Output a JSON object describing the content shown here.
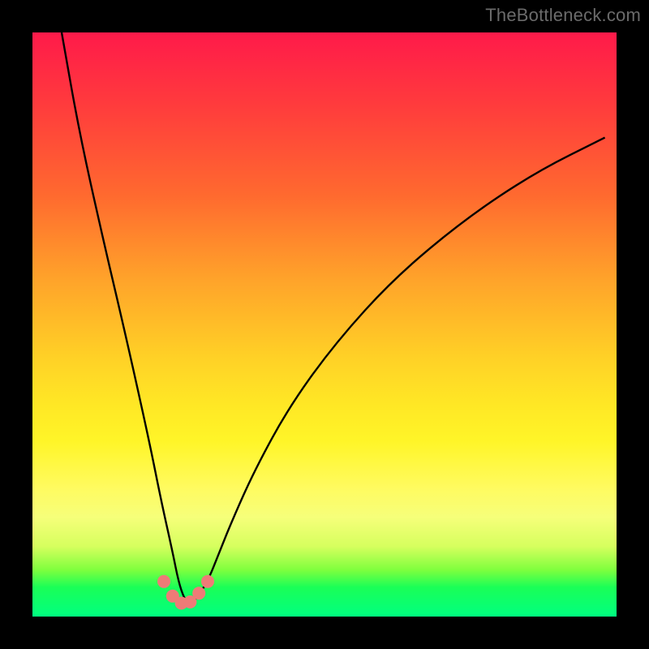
{
  "watermark": "TheBottleneck.com",
  "colors": {
    "background": "#000000",
    "gradient_top": "#ff1a4a",
    "gradient_bottom": "#00ff80",
    "curve": "#000000",
    "marker": "#ee7b77",
    "watermark": "#6b6b6b"
  },
  "chart_data": {
    "type": "line",
    "title": "",
    "xlabel": "",
    "ylabel": "",
    "xlim": [
      0,
      100
    ],
    "ylim": [
      0,
      100
    ],
    "grid": false,
    "legend": false,
    "series": [
      {
        "name": "curve",
        "x": [
          5,
          8,
          12,
          16,
          20,
          22,
          24,
          25,
          26,
          27,
          28,
          30,
          32,
          34,
          38,
          44,
          52,
          62,
          74,
          86,
          98
        ],
        "values": [
          100,
          83,
          65,
          48,
          30,
          20,
          11,
          6,
          3,
          2,
          3,
          6,
          11,
          16,
          25,
          36,
          47,
          58,
          68,
          76,
          82
        ]
      }
    ],
    "markers": {
      "name": "red-dots-near-min",
      "x": [
        22.5,
        24.0,
        25.5,
        27.0,
        28.5,
        30.0
      ],
      "values": [
        6.0,
        3.5,
        2.3,
        2.5,
        4.0,
        6.0
      ]
    },
    "annotations": [
      {
        "text": "TheBottleneck.com",
        "pos": "top-right"
      }
    ]
  }
}
